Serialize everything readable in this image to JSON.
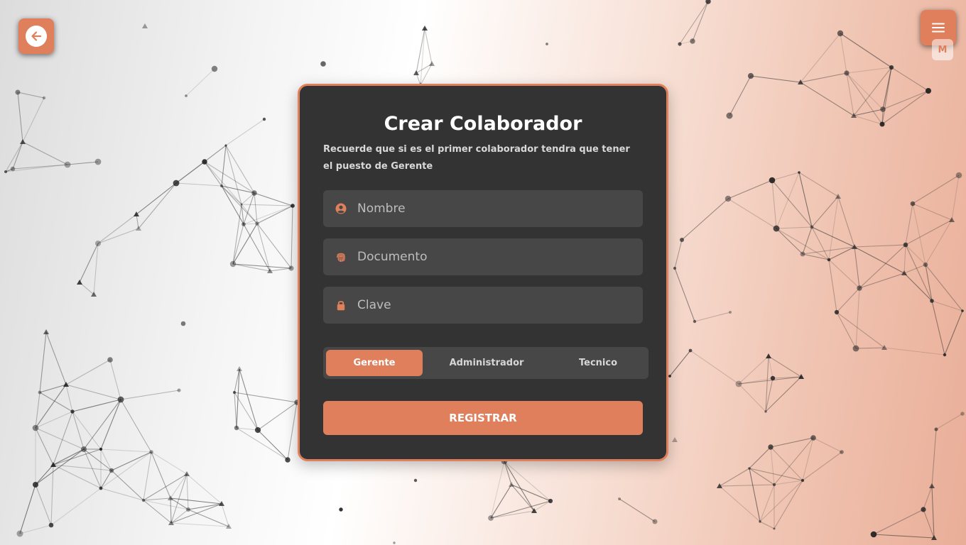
{
  "header": {
    "back_icon": "arrow-left-icon",
    "menu_icon": "hamburger-menu-icon",
    "user_badge": "M"
  },
  "form": {
    "title": "Crear Colaborador",
    "subtitle": "Recuerde que si es el primer colaborador tendra que tener el puesto de Gerente",
    "fields": [
      {
        "icon": "user-circle-icon",
        "placeholder": "Nombre",
        "value": ""
      },
      {
        "icon": "fingerprint-icon",
        "placeholder": "Documento",
        "value": ""
      },
      {
        "icon": "lock-icon",
        "placeholder": "Clave",
        "value": ""
      }
    ],
    "roles": [
      {
        "label": "Gerente",
        "selected": true
      },
      {
        "label": "Administrador",
        "selected": false
      },
      {
        "label": "Tecnico",
        "selected": false
      }
    ],
    "submit_label": "REGISTRAR"
  },
  "colors": {
    "accent": "#df7f5c",
    "card_background": "#333333",
    "field_background": "#474747"
  }
}
